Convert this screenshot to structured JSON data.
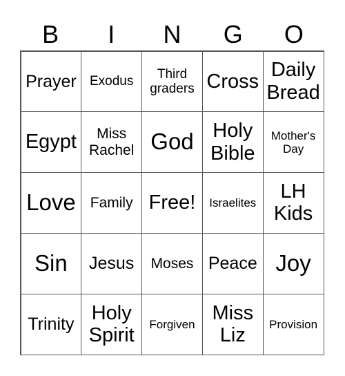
{
  "title_letters": [
    "B",
    "I",
    "N",
    "G",
    "O"
  ],
  "cells": [
    [
      "Prayer",
      "Exodus",
      "Third graders",
      "Cross",
      "Daily Bread"
    ],
    [
      "Egypt",
      "Miss Rachel",
      "God",
      "Holy Bible",
      "Mother's Day"
    ],
    [
      "Love",
      "Family",
      "Free!",
      "Israelites",
      "LH Kids"
    ],
    [
      "Sin",
      "Jesus",
      "Moses",
      "Peace",
      "Joy"
    ],
    [
      "Trinity",
      "Holy Spirit",
      "Forgiven",
      "Miss Liz",
      "Provision"
    ]
  ]
}
